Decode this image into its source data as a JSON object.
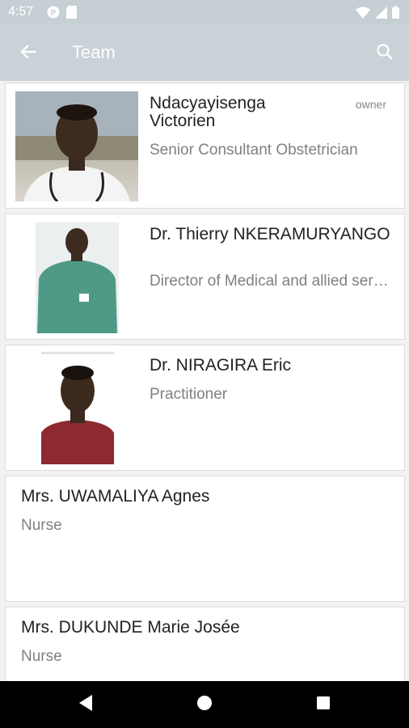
{
  "status_bar": {
    "time": "4:57",
    "left_icons": [
      "app-notification-icon",
      "sd-card-icon"
    ],
    "right_icons": [
      "wifi-icon",
      "cell-signal-icon",
      "battery-icon"
    ]
  },
  "app_bar": {
    "title": "Team",
    "back_icon": "arrow-left-icon",
    "search_icon": "search-icon"
  },
  "team": [
    {
      "name": "Ndacyayisenga Victorien",
      "role": "Senior Consultant Obstetrician",
      "badge": "owner",
      "has_photo": true
    },
    {
      "name": "Dr. Thierry NKERAMURYANGO",
      "role": "Director of Medical and allied services",
      "has_photo": true
    },
    {
      "name": "Dr. NIRAGIRA Eric",
      "role": "Practitioner",
      "has_photo": true
    },
    {
      "name": "Mrs. UWAMALIYA Agnes",
      "role": "Nurse",
      "has_photo": false
    },
    {
      "name": "Mrs. DUKUNDE Marie Josée",
      "role": "Nurse",
      "has_photo": false
    }
  ],
  "nav_bar": {
    "back": "nav-back-icon",
    "home": "nav-home-icon",
    "recents": "nav-recents-icon"
  },
  "colors": {
    "app_bar": "#c9d2d6",
    "status_bar": "#c6cfd3",
    "background": "#f2f2f2",
    "role_text": "#808080"
  }
}
